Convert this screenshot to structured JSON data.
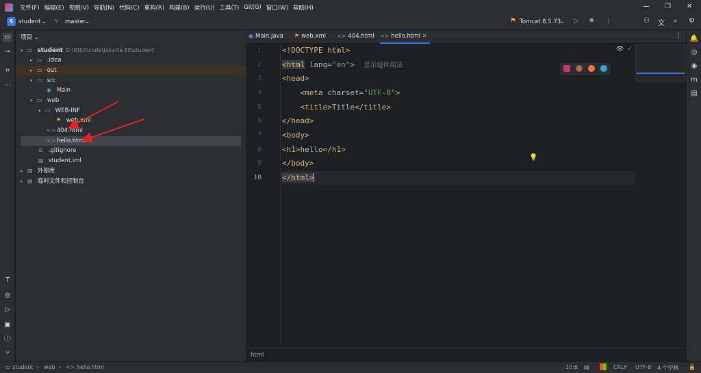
{
  "menubar": {
    "items": [
      "文件(F)",
      "编辑(E)",
      "视图(V)",
      "导航(N)",
      "代码(C)",
      "重构(R)",
      "构建(B)",
      "运行(U)",
      "工具(T)",
      "Git(G)",
      "窗口(W)",
      "帮助(H)"
    ],
    "window_controls": [
      "—",
      "❐",
      "✕"
    ]
  },
  "toolbar": {
    "project_badge": "S",
    "project_name": "student",
    "branch": "master",
    "run_config": "Tomcat 8.5.73"
  },
  "project": {
    "header": "项目",
    "tree": [
      {
        "label": "student",
        "path": "D:\\IDEA\\code\\Jakarta EE\\student"
      },
      {
        "label": ".idea"
      },
      {
        "label": "out"
      },
      {
        "label": "src"
      },
      {
        "label": "Main"
      },
      {
        "label": "web"
      },
      {
        "label": "WEB-INF"
      },
      {
        "label": "web.xml"
      },
      {
        "label": "404.html"
      },
      {
        "label": "hello.html"
      },
      {
        "label": ".gitignore"
      },
      {
        "label": "student.iml"
      },
      {
        "label": "外部库"
      },
      {
        "label": "临时文件和控制台"
      }
    ]
  },
  "editor": {
    "tabs": [
      "Main.java",
      "web.xml",
      "404.html",
      "hello.html"
    ],
    "active_tab": "hello.html",
    "line_numbers": [
      "1",
      "2",
      "3",
      "4",
      "5",
      "6",
      "7",
      "8",
      "9",
      "10"
    ],
    "inline_hint": "显示组件用法",
    "breadcrumb_bottom": "html",
    "code": {
      "l1_doctype": "<!DOCTYPE html>",
      "l2_open": "<html",
      "l2_attr": " lang=",
      "l2_val": "\"en\"",
      "l2_close": ">",
      "l3": "<head>",
      "l4_open": "<meta",
      "l4_attr": " charset=",
      "l4_val": "\"UTF-8\"",
      "l4_close": ">",
      "l5_open": "<title>",
      "l5_text": "Title",
      "l5_close": "</title>",
      "l6": "</head>",
      "l7": "<body>",
      "l8_open": "<h1>",
      "l8_text": "hello",
      "l8_close": "</h1>",
      "l9": "</body>",
      "l10": "</html>"
    }
  },
  "status": {
    "breadcrumb": [
      "student",
      "web",
      "hello.html"
    ],
    "position": "10:8",
    "line_ending": "CRLF",
    "encoding": "UTF-8",
    "indent": "4 个空格"
  },
  "colors": {
    "annotation_arrow": "#e02424",
    "accent": "#3574f0"
  }
}
